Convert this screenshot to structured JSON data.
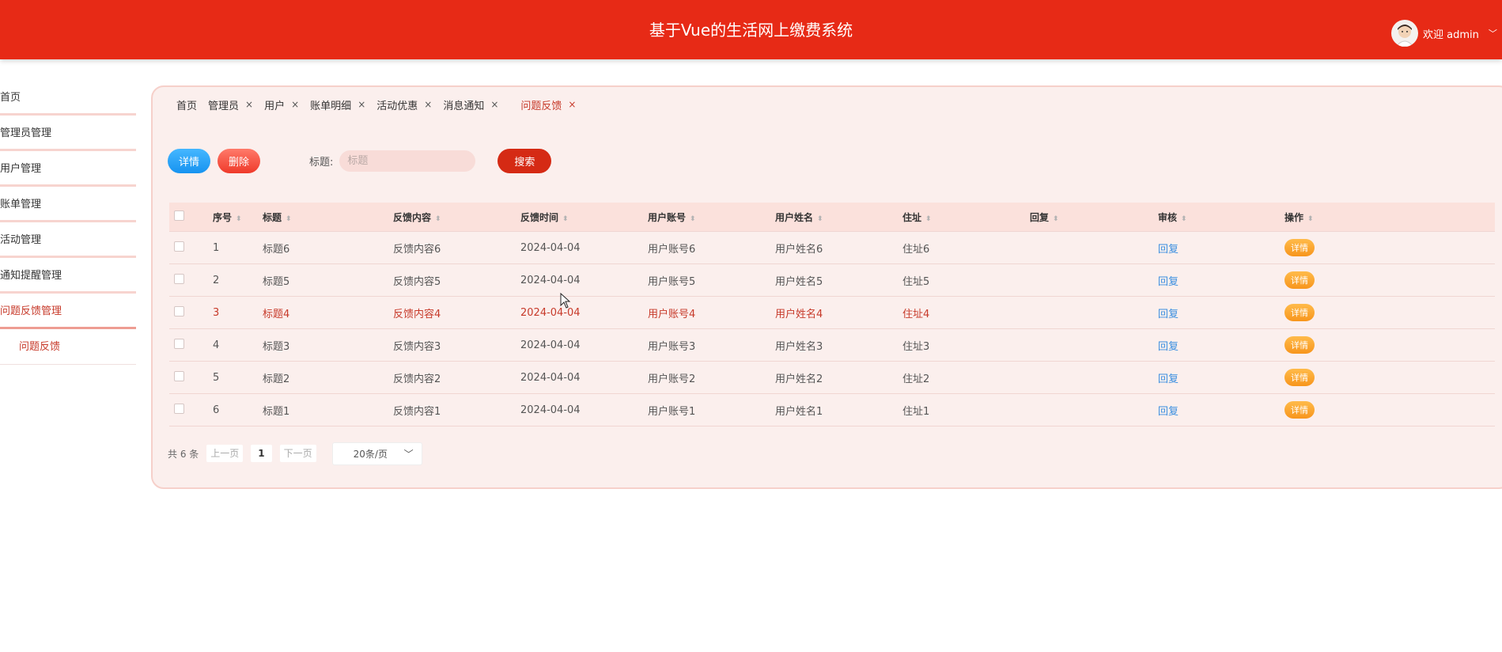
{
  "header": {
    "title": "基于Vue的生活网上缴费系统",
    "welcome": "欢迎 admin"
  },
  "sidebar": {
    "items": [
      {
        "label": "首页"
      },
      {
        "label": "管理员管理"
      },
      {
        "label": "用户管理"
      },
      {
        "label": "账单管理"
      },
      {
        "label": "活动管理"
      },
      {
        "label": "通知提醒管理"
      },
      {
        "label": "问题反馈管理"
      }
    ],
    "sub_item": "问题反馈"
  },
  "tabs": [
    {
      "label": "首页"
    },
    {
      "label": "管理员"
    },
    {
      "label": "用户"
    },
    {
      "label": "账单明细"
    },
    {
      "label": "活动优惠"
    },
    {
      "label": "消息通知"
    },
    {
      "label": "问题反馈"
    }
  ],
  "tab_close": "×",
  "toolbar": {
    "detail_label": "详情",
    "delete_label": "删除",
    "search_label": "标题:",
    "search_placeholder": "标题",
    "search_button": "搜索"
  },
  "table": {
    "headers": [
      "序号",
      "标题",
      "反馈内容",
      "反馈时间",
      "用户账号",
      "用户姓名",
      "住址",
      "回复",
      "审核",
      "操作"
    ],
    "rows": [
      {
        "no": "1",
        "title": "标题6",
        "content": "反馈内容6",
        "time": "2024-04-04",
        "account": "用户账号6",
        "name": "用户姓名6",
        "address": "住址6",
        "reply": "",
        "review": "回复",
        "action": "详情"
      },
      {
        "no": "2",
        "title": "标题5",
        "content": "反馈内容5",
        "time": "2024-04-04",
        "account": "用户账号5",
        "name": "用户姓名5",
        "address": "住址5",
        "reply": "",
        "review": "回复",
        "action": "详情"
      },
      {
        "no": "3",
        "title": "标题4",
        "content": "反馈内容4",
        "time": "2024-04-04",
        "account": "用户账号4",
        "name": "用户姓名4",
        "address": "住址4",
        "reply": "",
        "review": "回复",
        "action": "详情"
      },
      {
        "no": "4",
        "title": "标题3",
        "content": "反馈内容3",
        "time": "2024-04-04",
        "account": "用户账号3",
        "name": "用户姓名3",
        "address": "住址3",
        "reply": "",
        "review": "回复",
        "action": "详情"
      },
      {
        "no": "5",
        "title": "标题2",
        "content": "反馈内容2",
        "time": "2024-04-04",
        "account": "用户账号2",
        "name": "用户姓名2",
        "address": "住址2",
        "reply": "",
        "review": "回复",
        "action": "详情"
      },
      {
        "no": "6",
        "title": "标题1",
        "content": "反馈内容1",
        "time": "2024-04-04",
        "account": "用户账号1",
        "name": "用户姓名1",
        "address": "住址1",
        "reply": "",
        "review": "回复",
        "action": "详情"
      }
    ]
  },
  "pagination": {
    "total": "共 6 条",
    "prev": "上一页",
    "page": "1",
    "next": "下一页",
    "page_size": "20条/页"
  },
  "colors": {
    "header": "#e72a16",
    "accent": "#c73a2a",
    "link": "#3b8fe0"
  }
}
